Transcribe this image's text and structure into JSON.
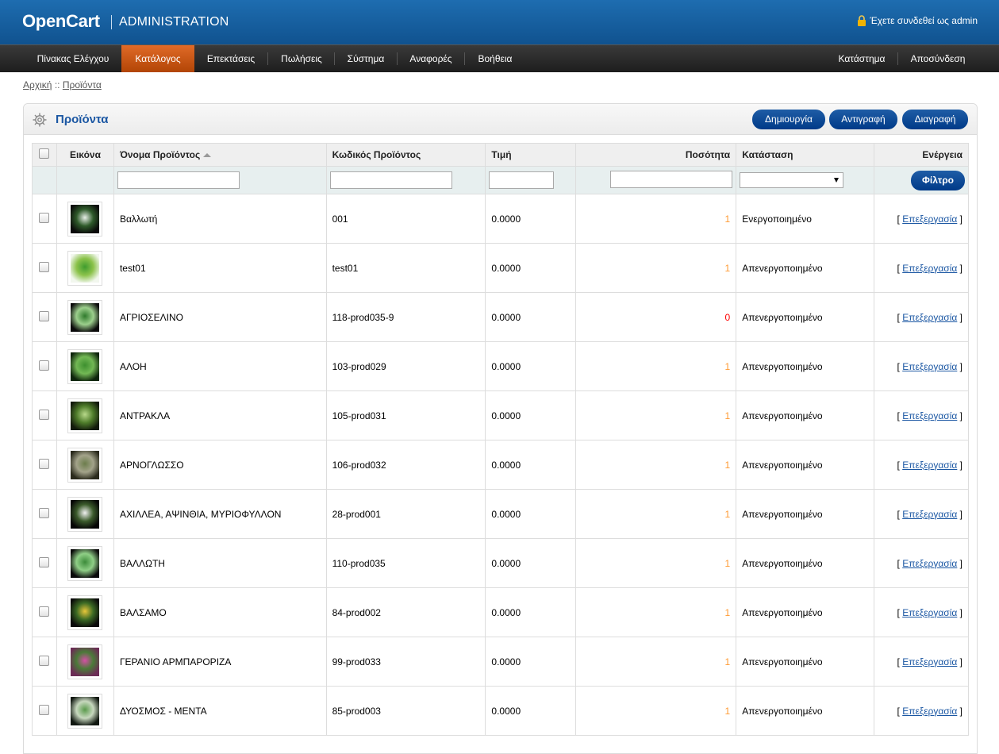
{
  "header": {
    "logo": "OpenCart",
    "admin": "ADMINISTRATION",
    "logged_in": "Έχετε συνδεθεί ως admin"
  },
  "menu": {
    "items": [
      {
        "label": "Πίνακας Ελέγχου"
      },
      {
        "label": "Κατάλογος",
        "active": true
      },
      {
        "label": "Επεκτάσεις"
      },
      {
        "label": "Πωλήσεις"
      },
      {
        "label": "Σύστημα"
      },
      {
        "label": "Αναφορές"
      },
      {
        "label": "Βοήθεια"
      }
    ],
    "right": [
      {
        "label": "Κατάστημα"
      },
      {
        "label": "Αποσύνδεση"
      }
    ]
  },
  "breadcrumb": {
    "home": "Αρχική",
    "separator": "::",
    "current": "Προϊόντα"
  },
  "box": {
    "title": "Προϊόντα",
    "buttons": {
      "create": "Δημιουργία",
      "copy": "Αντιγραφή",
      "delete": "Διαγραφή"
    }
  },
  "table": {
    "headers": {
      "image": "Εικόνα",
      "name": "Όνομα Προϊόντος",
      "model": "Κωδικός Προϊόντος",
      "price": "Τιμή",
      "quantity": "Ποσότητα",
      "status": "Κατάσταση",
      "action": "Ενέργεια"
    },
    "filter_button": "Φίλτρο",
    "edit_label": "Επεξεργασία",
    "rows": [
      {
        "name": "Βαλλωτή",
        "model": "001",
        "price": "0.0000",
        "quantity": "1",
        "status": "Ενεργοποιημένο",
        "thumb_colors": [
          "#0a0a0a",
          "#e8efe8",
          "#2e5a2a"
        ]
      },
      {
        "name": "test01",
        "model": "test01",
        "price": "0.0000",
        "quantity": "1",
        "status": "Απενεργοποιημένο",
        "thumb_colors": [
          "#f2f7ee",
          "#3f9c2e",
          "#8cc34b"
        ]
      },
      {
        "name": "ΑΓΡΙΟΣΕΛΙΝΟ",
        "model": "118-prod035-9",
        "price": "0.0000",
        "quantity": "0",
        "status": "Απενεργοποιημένο",
        "thumb_colors": [
          "#0b0b0b",
          "#2f7a2c",
          "#9ccf8c"
        ]
      },
      {
        "name": "ΑΛΟΗ",
        "model": "103-prod029",
        "price": "0.0000",
        "quantity": "1",
        "status": "Απενεργοποιημένο",
        "thumb_colors": [
          "#0e250c",
          "#3d8f2f",
          "#72b854"
        ]
      },
      {
        "name": "ΑΝΤΡΑΚΛΑ",
        "model": "105-prod031",
        "price": "0.0000",
        "quantity": "1",
        "status": "Απενεργοποιημένο",
        "thumb_colors": [
          "#121a0c",
          "#b8d98a",
          "#4e7c2a"
        ]
      },
      {
        "name": "ΑΡΝΟΓΛΩΣΣΟ",
        "model": "106-prod032",
        "price": "0.0000",
        "quantity": "1",
        "status": "Απενεργοποιημένο",
        "thumb_colors": [
          "#2a2a1c",
          "#6c7d4c",
          "#a3a38a"
        ]
      },
      {
        "name": "ΑΧΙΛΛΕΑ, ΑΨΙΝΘΙΑ, ΜΥΡΙΟΦΥΛΛΟΝ",
        "model": "28-prod001",
        "price": "0.0000",
        "quantity": "1",
        "status": "Απενεργοποιημένο",
        "thumb_colors": [
          "#050505",
          "#f1f1f1",
          "#3b5b2b"
        ]
      },
      {
        "name": "ΒΑΛΛΩΤΗ",
        "model": "110-prod035",
        "price": "0.0000",
        "quantity": "1",
        "status": "Απενεργοποιημένο",
        "thumb_colors": [
          "#0a0a0a",
          "#3c8b3a",
          "#8fcf86"
        ]
      },
      {
        "name": "ΒΑΛΣΑΜΟ",
        "model": "84-prod002",
        "price": "0.0000",
        "quantity": "1",
        "status": "Απενεργοποιημένο",
        "thumb_colors": [
          "#0a0a0a",
          "#e7c73a",
          "#3b6a24"
        ]
      },
      {
        "name": "ΓΕΡΑΝΙΟ ΑΡΜΠΑΡΟΡΙΖΑ",
        "model": "99-prod033",
        "price": "0.0000",
        "quantity": "1",
        "status": "Απενεργοποιημένο",
        "thumb_colors": [
          "#6b2c55",
          "#d44fa5",
          "#4a7a38"
        ]
      },
      {
        "name": "ΔΥΟΣΜΟΣ - ΜΕΝΤΑ",
        "model": "85-prod003",
        "price": "0.0000",
        "quantity": "1",
        "status": "Απενεργοποιημένο",
        "thumb_colors": [
          "#111811",
          "#5a9a4c",
          "#c7d8be"
        ]
      }
    ]
  },
  "colors": {
    "header_blue": "#1565a8",
    "menu_dark": "#2b2b2b",
    "menu_active": "#d3601c",
    "button_blue": "#0a4a96",
    "qty_ok": "#ff9a33",
    "qty_zero": "#ff0000"
  }
}
